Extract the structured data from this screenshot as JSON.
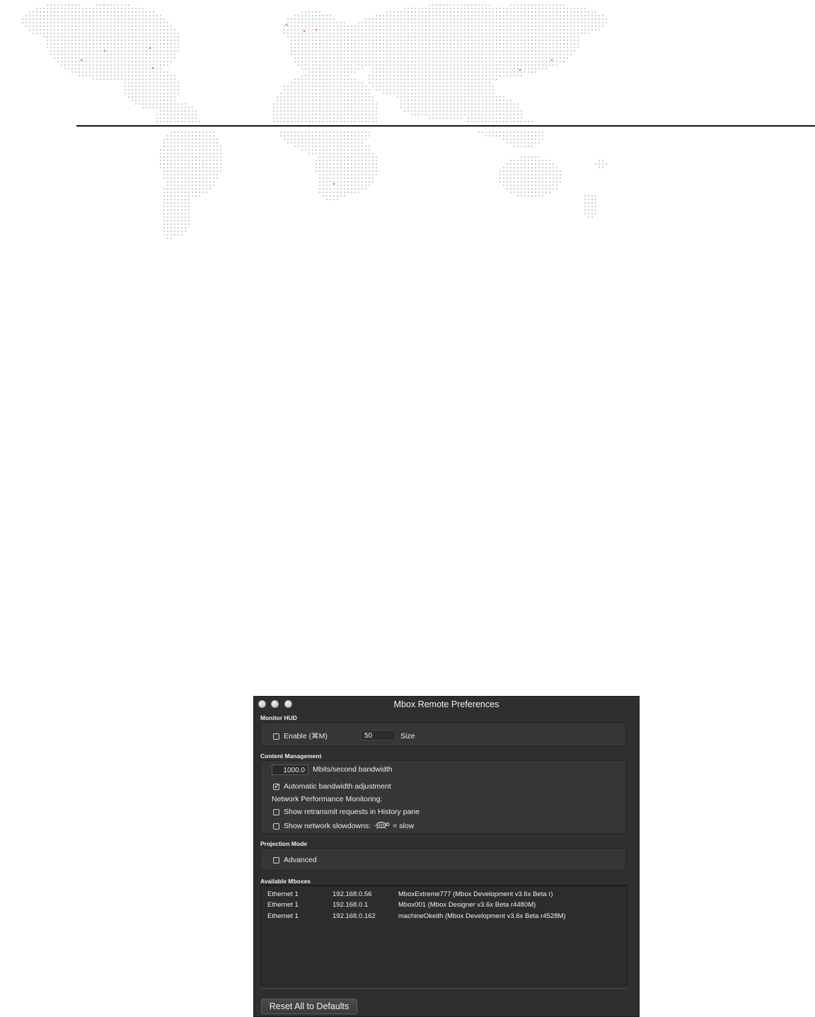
{
  "window": {
    "title": "Mbox Remote Preferences"
  },
  "monitor_hud": {
    "section_label": "Monitor HUD",
    "enable_label": "Enable (⌘M)",
    "enable_checked": false,
    "size_value": "50",
    "size_label": "Size"
  },
  "content_management": {
    "section_label": "Content Management",
    "bandwidth_value": "1000.0",
    "bandwidth_label": "Mbits/second bandwidth",
    "auto_bandwidth_label": "Automatic bandwidth adjustment",
    "auto_bandwidth_checked": true,
    "network_perf_label": "Network Performance Monitoring:",
    "show_retransmit_label": "Show retransmit requests in History pane",
    "show_retransmit_checked": false,
    "show_slowdowns_label": "Show network slowdowns:",
    "slow_suffix": "= slow",
    "show_slowdowns_checked": false,
    "turtle_icon": "turtle-icon"
  },
  "projection_mode": {
    "section_label": "Projection Mode",
    "advanced_label": "Advanced",
    "advanced_checked": false
  },
  "available_mboxes": {
    "section_label": "Available Mboxes",
    "rows": [
      {
        "interface": "Ethernet 1",
        "ip": "192.168.0.56",
        "name": "MboxExtreme777 (Mbox Development v3.6x Beta r)"
      },
      {
        "interface": "Ethernet 1",
        "ip": "192.168.0.1",
        "name": "Mbox001 (Mbox Designer v3.6x Beta r4480M)"
      },
      {
        "interface": "Ethernet 1",
        "ip": "192.168.0.162",
        "name": "machineOkeith (Mbox Development v3.6x Beta r4528M)"
      }
    ]
  },
  "reset_button_label": "Reset All to Defaults",
  "colors": {
    "window_bg": "#2f2f2f",
    "map_dot": "#c8c8c8",
    "map_accent_dot": "#e07070"
  }
}
